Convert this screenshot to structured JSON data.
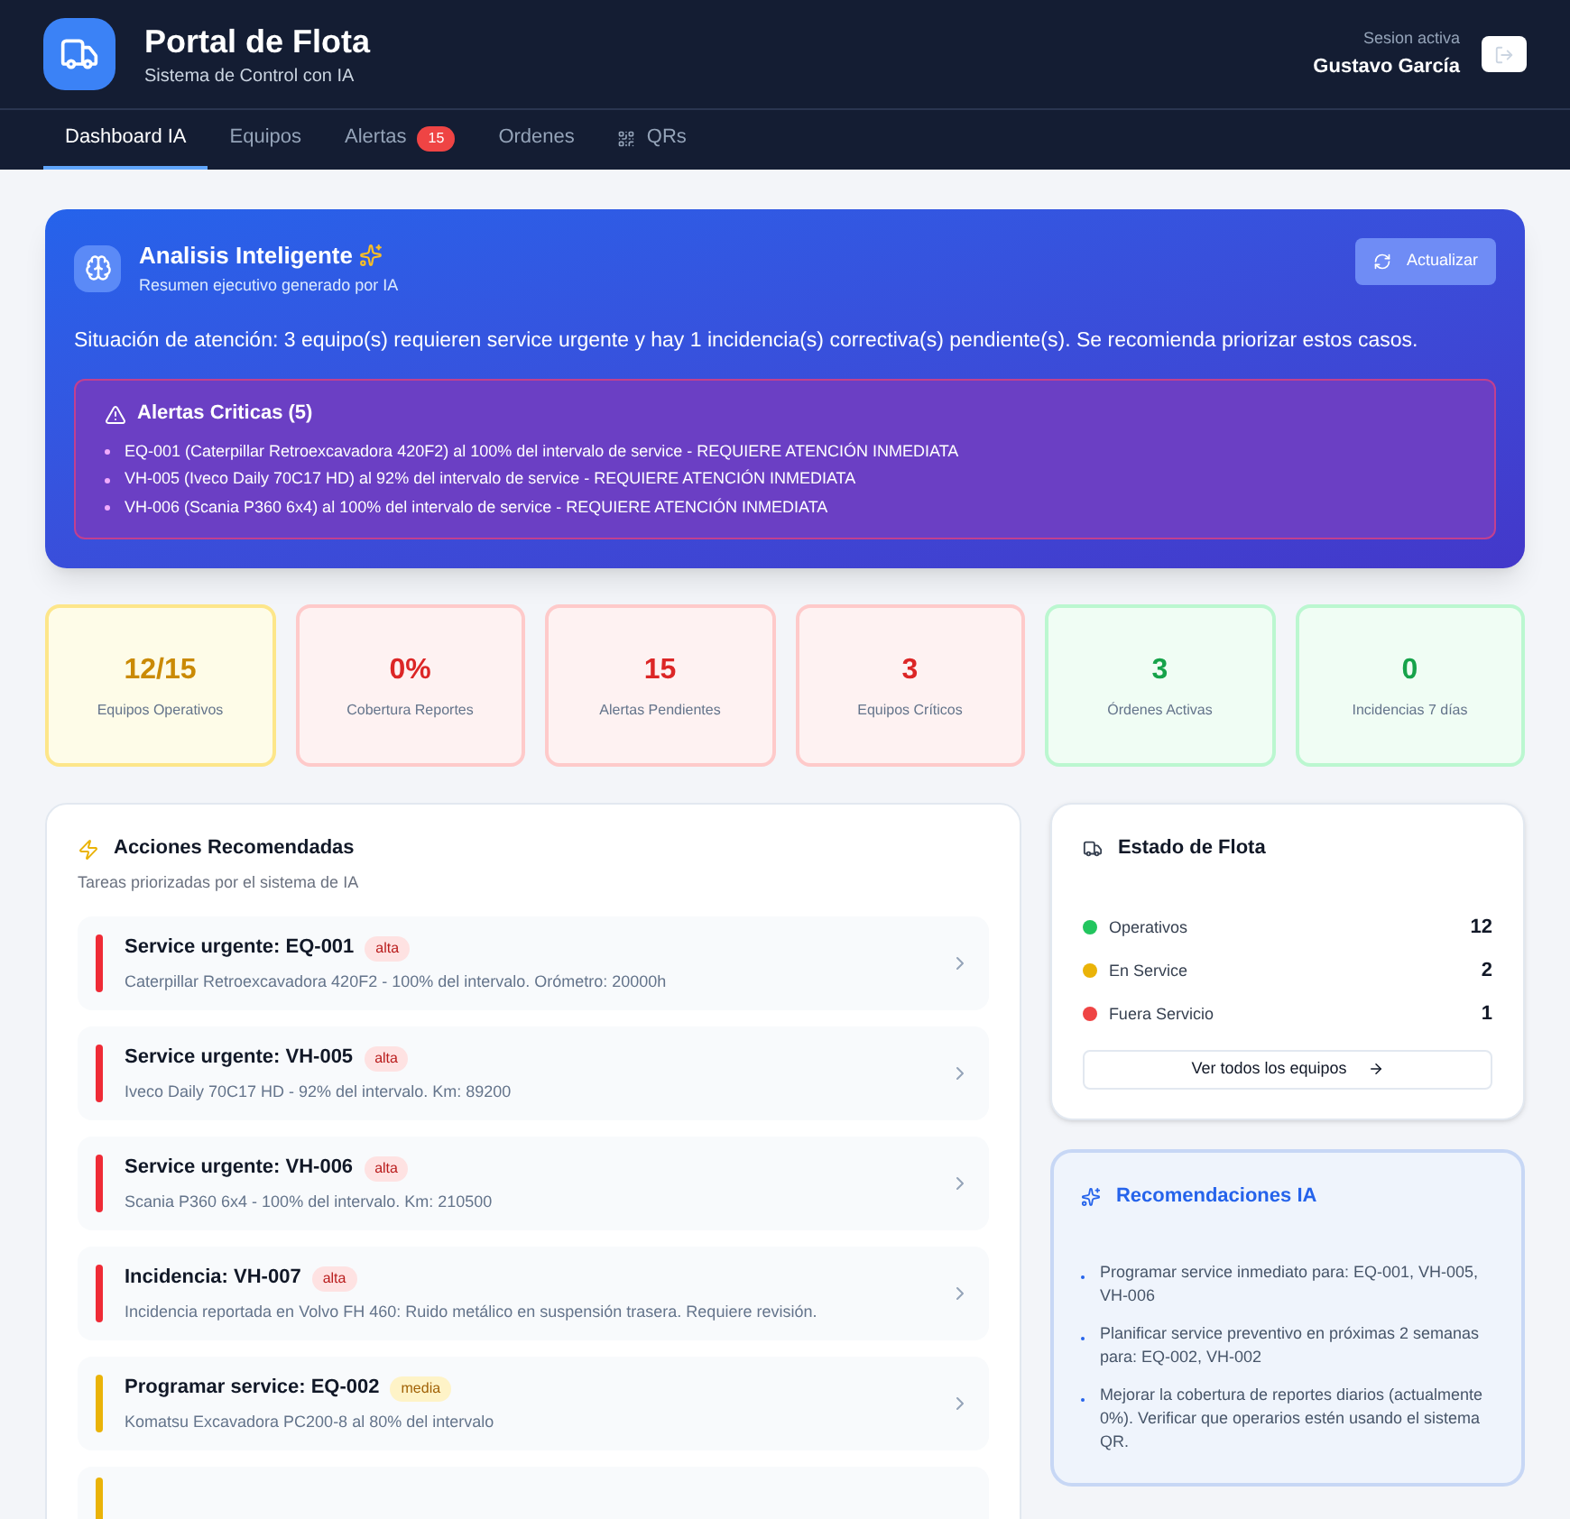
{
  "header": {
    "title": "Portal de Flota",
    "subtitle": "Sistema de Control con IA",
    "session_label": "Sesion activa",
    "user": "Gustavo García"
  },
  "tabs": [
    {
      "label": "Dashboard IA",
      "selected": true
    },
    {
      "label": "Equipos",
      "selected": false
    },
    {
      "label": "Alertas",
      "selected": false,
      "badge": "15"
    },
    {
      "label": "Ordenes",
      "selected": false
    },
    {
      "label": "QRs",
      "selected": false,
      "kind": "qr"
    }
  ],
  "analysis": {
    "title": "Analisis Inteligente",
    "subtitle": "Resumen ejecutivo generado por IA",
    "refresh_button": "Actualizar",
    "summary": "Situación de atención: 3 equipo(s) requieren service urgente y hay 1 incidencia(s) correctiva(s) pendiente(s). Se recomienda priorizar estos casos.",
    "alerts_title": "Alertas Criticas (5)",
    "alerts": [
      "EQ-001 (Caterpillar Retroexcavadora 420F2) al 100% del intervalo de service - REQUIERE ATENCIÓN INMEDIATA",
      "VH-005 (Iveco Daily 70C17 HD) al 92% del intervalo de service - REQUIERE ATENCIÓN INMEDIATA",
      "VH-006 (Scania P360 6x4) al 100% del intervalo de service - REQUIERE ATENCIÓN INMEDIATA"
    ]
  },
  "stats": [
    {
      "value": "12/15",
      "label": "Equipos Operativos",
      "color": "#ca8a04"
    },
    {
      "value": "0%",
      "label": "Cobertura Reportes",
      "color": "#dc2626"
    },
    {
      "value": "15",
      "label": "Alertas Pendientes",
      "color": "#dc2626"
    },
    {
      "value": "3",
      "label": "Equipos Críticos",
      "color": "#dc2626"
    },
    {
      "value": "3",
      "label": "Órdenes Activas",
      "color": "#16a34a"
    },
    {
      "value": "0",
      "label": "Incidencias 7 días",
      "color": "#16a34a"
    }
  ],
  "actions": {
    "title": "Acciones Recomendadas",
    "subtitle": "Tareas priorizadas por el sistema de IA",
    "items": [
      {
        "title": "Service urgente: EQ-001",
        "priority": "alta",
        "detail": "Caterpillar Retroexcavadora 420F2 - 100% del intervalo. Orómetro: 20000h"
      },
      {
        "title": "Service urgente: VH-005",
        "priority": "alta",
        "detail": "Iveco Daily 70C17 HD - 92% del intervalo. Km: 89200"
      },
      {
        "title": "Service urgente: VH-006",
        "priority": "alta",
        "detail": "Scania P360 6x4 - 100% del intervalo. Km: 210500"
      },
      {
        "title": "Incidencia: VH-007",
        "priority": "alta",
        "detail": "Incidencia reportada en Volvo FH 460: Ruido metálico en suspensión trasera. Requiere revisión."
      },
      {
        "title": "Programar service: EQ-002",
        "priority": "media",
        "detail": "Komatsu Excavadora PC200-8 al 80% del intervalo"
      },
      {
        "color": "#eab308"
      }
    ]
  },
  "fleet": {
    "title": "Estado de Flota",
    "rows": [
      {
        "label": "Operativos",
        "count": "12",
        "color": "#22c55e"
      },
      {
        "label": "En Service",
        "count": "2",
        "color": "#eab308"
      },
      {
        "label": "Fuera Servicio",
        "count": "1",
        "color": "#ef4444"
      }
    ],
    "button": "Ver todos los equipos"
  },
  "recommendations": {
    "title": "Recomendaciones IA",
    "items": [
      "Programar service inmediato para: EQ-001, VH-005, VH-006",
      "Planificar service preventivo en próximas 2 semanas para: EQ-002, VH-002",
      "Mejorar la cobertura de reportes diarios (actualmente 0%). Verificar que operarios estén usando el sistema QR."
    ]
  }
}
